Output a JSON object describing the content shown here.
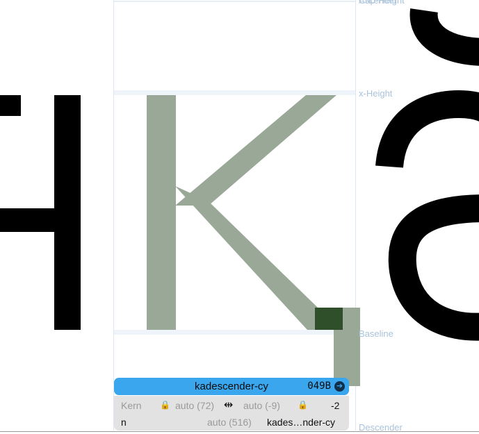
{
  "metric_lines": {
    "cap_height_label": "Cap-Height",
    "ascender_label": "Ascender",
    "x_height_label": "x-Height",
    "baseline_label": "Baseline",
    "descender_label": "Descender"
  },
  "glyph_info": {
    "name": "kadescender-cy",
    "unicode": "049B",
    "goto_icon": "arrow-circle-right-icon"
  },
  "metrics": {
    "kern_label": "Kern",
    "left_kern": "auto (72)",
    "right_kern": "auto (-9)",
    "kern_value": "-2",
    "left_glyph": "n",
    "width": "auto (516)",
    "right_glyph": "kades…nder-cy",
    "kern_icon": "kerning-cursor-icon",
    "lock_icon": "lock-icon"
  },
  "colors": {
    "glyph_fill": "#9aa898",
    "overlap_fill": "#2f4f2a",
    "metric_line": "#dbe8f3",
    "metric_label": "#a9c3db",
    "header_blue": "#3aa6ee",
    "panel_gray": "#e2e2e2"
  }
}
